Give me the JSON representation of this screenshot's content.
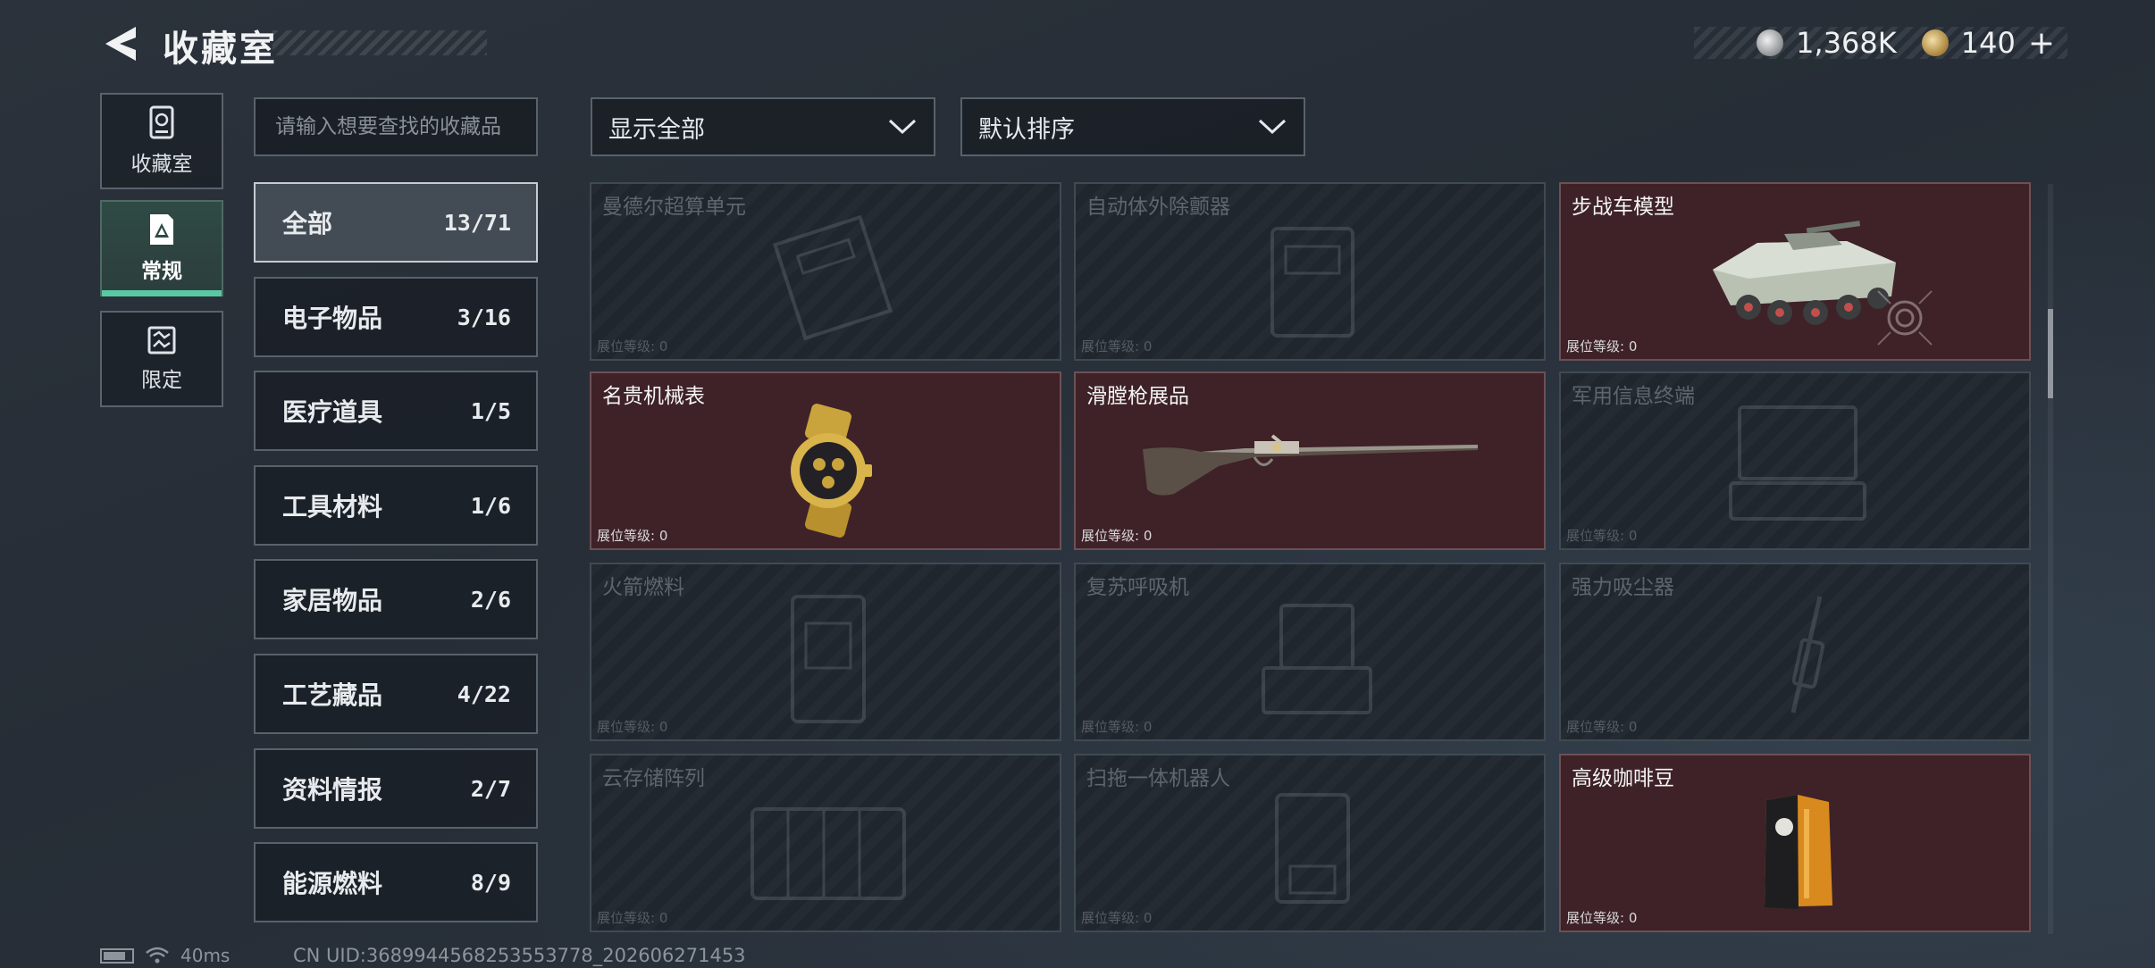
{
  "header": {
    "title": "收藏室"
  },
  "currency": {
    "silver_amount": "1,368K",
    "gold_amount": "140",
    "add_label": "+"
  },
  "rail": [
    {
      "label": "收藏室",
      "icon": "vault-icon",
      "active": false
    },
    {
      "label": "常规",
      "icon": "regular-icon",
      "active": true
    },
    {
      "label": "限定",
      "icon": "limited-icon",
      "active": false
    }
  ],
  "search": {
    "placeholder": "请输入想要查找的收藏品"
  },
  "categories": [
    {
      "name": "全部",
      "count": "13/71",
      "active": true
    },
    {
      "name": "电子物品",
      "count": "3/16"
    },
    {
      "name": "医疗道具",
      "count": "1/5"
    },
    {
      "name": "工具材料",
      "count": "1/6"
    },
    {
      "name": "家居物品",
      "count": "2/6"
    },
    {
      "name": "工艺藏品",
      "count": "4/22"
    },
    {
      "name": "资料情报",
      "count": "2/7"
    },
    {
      "name": "能源燃料",
      "count": "8/9"
    }
  ],
  "filters": {
    "display": "显示全部",
    "sort": "默认排序"
  },
  "collectibles": [
    {
      "name": "曼德尔超算单元",
      "level": "展位等级: 0",
      "owned": false,
      "icon": "computer-unit-icon"
    },
    {
      "name": "自动体外除颤器",
      "level": "展位等级: 0",
      "owned": false,
      "icon": "defibrillator-icon"
    },
    {
      "name": "步战车模型",
      "level": "展位等级: 0",
      "owned": true,
      "icon": "ifv-model-icon"
    },
    {
      "name": "名贵机械表",
      "level": "展位等级: 0",
      "owned": true,
      "icon": "watch-icon"
    },
    {
      "name": "滑膛枪展品",
      "level": "展位等级: 0",
      "owned": true,
      "icon": "musket-icon"
    },
    {
      "name": "军用信息终端",
      "level": "展位等级: 0",
      "owned": false,
      "icon": "military-terminal-icon"
    },
    {
      "name": "火箭燃料",
      "level": "展位等级: 0",
      "owned": false,
      "icon": "rocket-fuel-icon"
    },
    {
      "name": "复苏呼吸机",
      "level": "展位等级: 0",
      "owned": false,
      "icon": "ventilator-icon"
    },
    {
      "name": "强力吸尘器",
      "level": "展位等级: 0",
      "owned": false,
      "icon": "vacuum-icon"
    },
    {
      "name": "云存储阵列",
      "level": "展位等级: 0",
      "owned": false,
      "icon": "storage-array-icon"
    },
    {
      "name": "扫拖一体机器人",
      "level": "展位等级: 0",
      "owned": false,
      "icon": "robot-vacuum-icon"
    },
    {
      "name": "高级咖啡豆",
      "level": "展位等级: 0",
      "owned": true,
      "icon": "coffee-beans-icon"
    }
  ],
  "status": {
    "ping": "40ms",
    "uid": "CN UID:3689944568253553778_202606271453"
  },
  "colors": {
    "accent": "#59c7a1",
    "owned_card": "#3e2227",
    "locked_card": "#20262d"
  }
}
